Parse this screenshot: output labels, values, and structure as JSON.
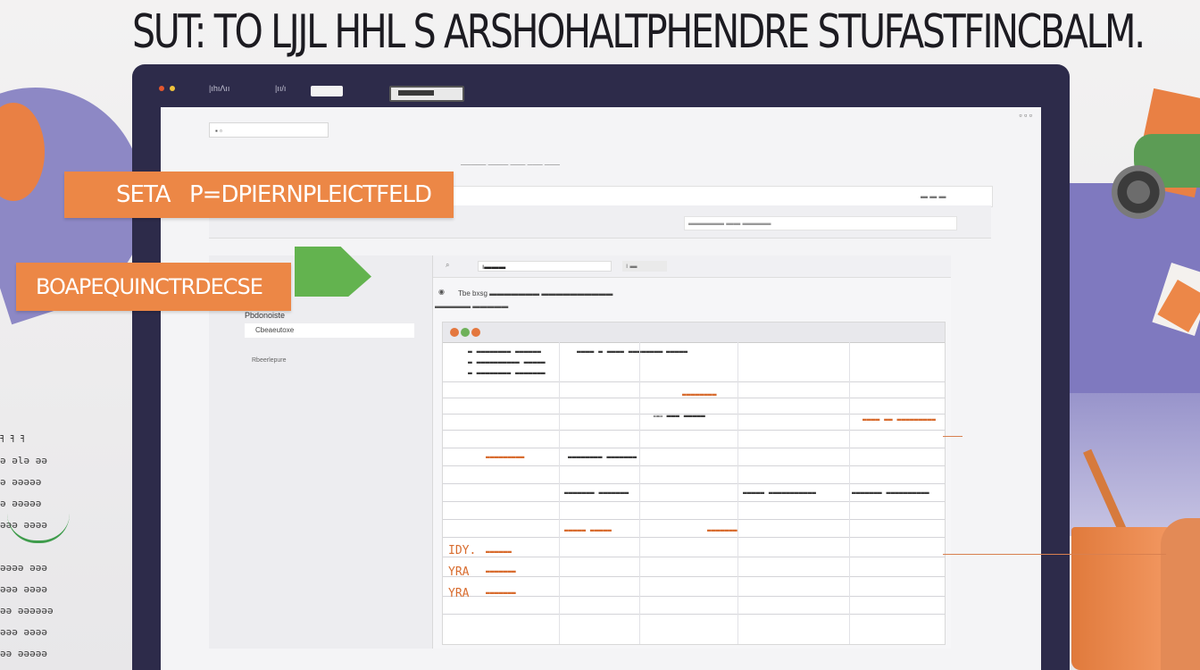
{
  "headline": "SUT: TO LJJL HHL S ARSHOHALTPHENDRE STUFASTFINCBALM.",
  "tags": {
    "tag1_part1": "SETA",
    "tag1_part2": "P=DPIERNPLEICTFELD",
    "tag2": "BOAPEQUINCTRDECSE"
  },
  "browser": {
    "tab1": "|ıhıΛıı",
    "tab2": "|ıı/ı"
  },
  "screen": {
    "win_controls": "▫ ▫ ▫",
    "toolbar_text": "▪ ▫",
    "top_small_line": "───── ──── ─── ─── ───",
    "header_small": "▬▬▬▬ ▬▬ ▬▬▬ ▬▬▬▬▬",
    "left_header_text": "▬▬▬▬▬▬▬▬ ▬▬ ▬▬▬▬▬",
    "right_header_text": "▬ ▬ ▬",
    "row_band_input": "▬▬▬▬▬ ▬▬ ▬▬▬▬",
    "left_pane": {
      "title": "Pbdonoiste",
      "item": "Cbeaeutoxe",
      "sub": "Rbeerlepure"
    },
    "content": {
      "toolbar_field": "ı▬▬▬",
      "toolbar_field2": "ı ▬",
      "info_line": "Tbe  bxsg  ▬▬▬▬▬▬▬ ▬▬▬▬▬▬▬▬▬▬",
      "info_sub": "▬▬▬▬▬ ▬▬▬▬▬",
      "grid_rows": [
        {
          "c1": "▬ ▬▬▬▬▬▬▬▬ ▬▬▬▬▬▬",
          "c2": "▬▬▬▬ ▬ ▬▬▬▬ ▬▬▬▬▬▬▬▬"
        },
        {
          "c1": "▬ ▬▬▬▬▬▬▬▬▬▬ ▬▬▬▬▬",
          "c2": "▬▬▬▬▬"
        },
        {
          "c1": "▬ ▬▬▬▬▬▬▬▬ ▬▬▬▬▬▬▬",
          "c2": ""
        }
      ],
      "hand_notes": [
        "▬▬▬▬▬▬▬▬",
        "▭▭ ▬▬▬ ▬▬▬▬▬",
        "▬▬▬▬ ▬▬ ▬▬▬▬▬▬▬▬▬",
        "▬▬▬▬▬▬▬▬▬",
        "▬▬▬▬▬▬▬▬ ▬▬▬▬▬▬▬",
        "IDY.",
        "▬▬▬▬▬▬",
        "YRA",
        "▬▬▬▬▬▬▬",
        "YRA",
        "▬▬▬▬▬▬▬"
      ],
      "col_notes": [
        "▬▬▬▬▬▬▬ ▬▬▬▬▬▬▬",
        "▬▬▬▬▬ ▬▬▬▬▬▬▬▬▬▬▬",
        "▬▬▬▬▬▬▬ ▬▬▬▬▬▬▬▬▬▬",
        "▬▬▬▬▬ ▬▬▬▬▬",
        "▬▬▬▬▬▬▬"
      ]
    }
  },
  "left_scribbles": "ߔ ߔ ߔ\nǝ ǝlǝ ǝǝ\nǝ ǝǝǝǝǝ\nǝ ǝǝǝǝǝ\nǝǝǝ ǝǝǝǝ\n\nǝǝǝǝ ǝǝǝ\nǝǝǝ ǝǝǝǝ\nǝǝ ǝǝǝǝǝǝ\nǝǝǝ ǝǝǝǝ\nǝǝ ǝǝǝǝǝ",
  "colors": {
    "accent_orange": "#ec8746",
    "accent_purple": "#7f79bf",
    "accent_green": "#63b34f",
    "frame_dark": "#2d2b4a"
  }
}
